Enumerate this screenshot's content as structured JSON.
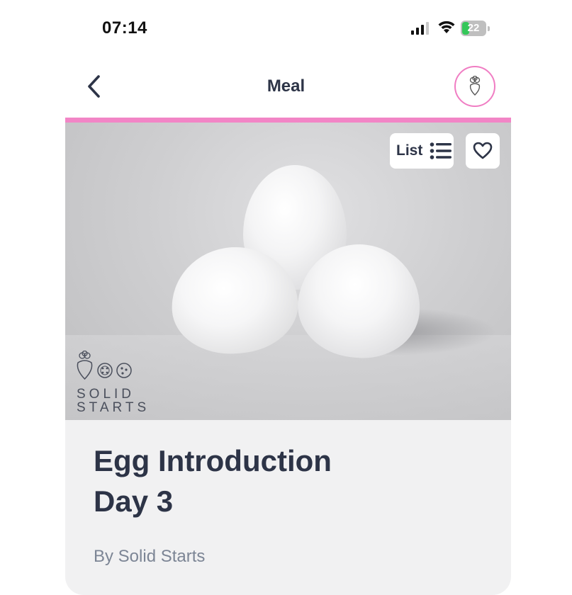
{
  "status_bar": {
    "time": "07:14",
    "battery": "22"
  },
  "nav": {
    "title": "Meal"
  },
  "hero": {
    "list_label": "List"
  },
  "brand": {
    "line1": "SOLID",
    "line2": "STARTS"
  },
  "meal": {
    "title_line1": "Egg Introduction",
    "title_line2": "Day 3",
    "author": "By Solid Starts"
  },
  "colors": {
    "accent_pink": "#f285c6",
    "text_dark": "#2d3447",
    "text_muted": "#7c8595",
    "card_bg": "#f1f1f2",
    "battery_green": "#34c759"
  },
  "icons": [
    "back-chevron-icon",
    "beet-logo-icon",
    "list-icon",
    "heart-icon",
    "signal-icon",
    "wifi-icon",
    "battery-icon"
  ]
}
